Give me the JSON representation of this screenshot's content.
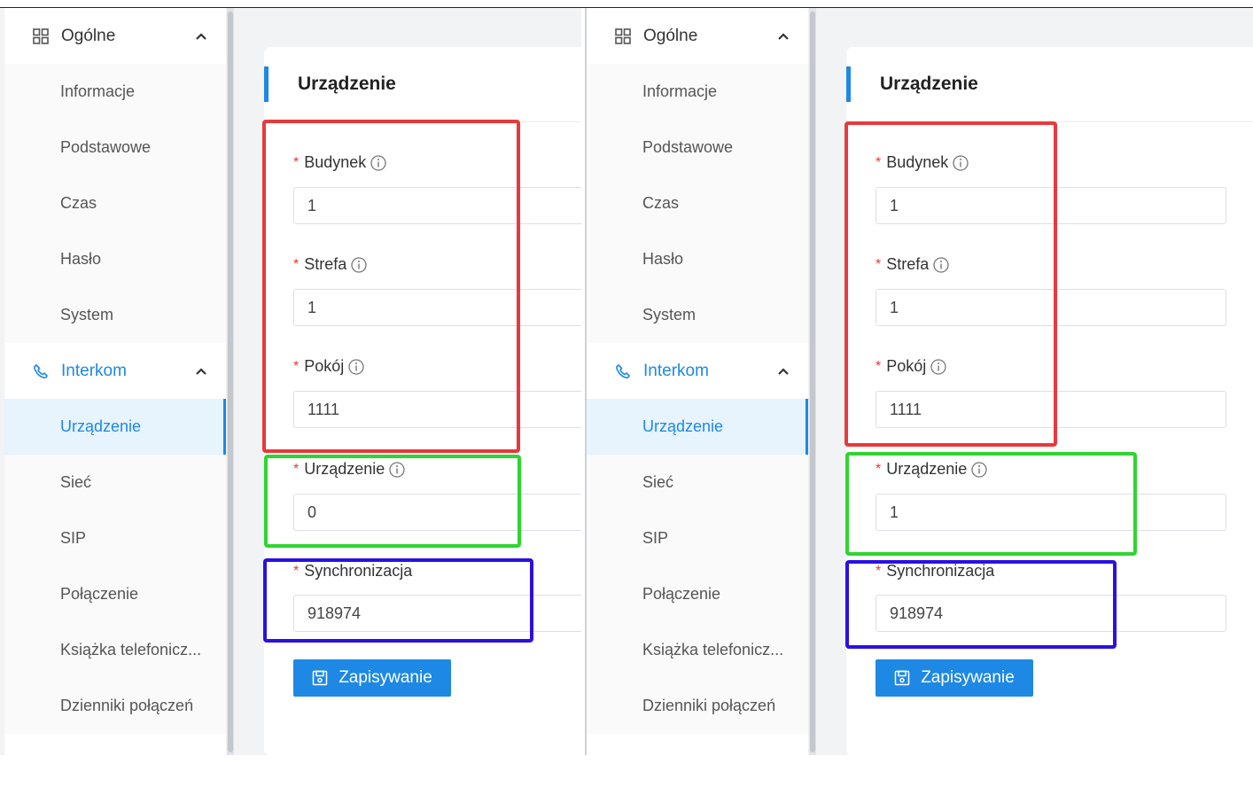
{
  "sidebar": {
    "group_general": "Ogólne",
    "items_general": [
      "Informacje",
      "Podstawowe",
      "Czas",
      "Hasło",
      "System"
    ],
    "group_intercom": "Interkom",
    "items_intercom": [
      "Urządzenie",
      "Sieć",
      "SIP",
      "Połączenie",
      "Książka telefonicz...",
      "Dzienniki połączeń"
    ],
    "active_item": "Urządzenie"
  },
  "card": {
    "title": "Urządzenie",
    "fields": {
      "building": "Budynek",
      "zone": "Strefa",
      "room": "Pokój",
      "device": "Urządzenie",
      "sync": "Synchronizacja"
    },
    "save_label": "Zapisywanie"
  },
  "left_panel": {
    "building": "1",
    "zone": "1",
    "room": "1111",
    "device": "0",
    "sync": "918974"
  },
  "right_panel": {
    "building": "1",
    "zone": "1",
    "room": "1111",
    "device": "1",
    "sync": "918974"
  },
  "icons": {
    "general": "grid-icon",
    "intercom": "phone-icon",
    "collapse": "chevron-up-icon",
    "info": "info-icon",
    "save": "save-icon"
  },
  "colors": {
    "accent": "#1e88e5",
    "highlight_red": "#e8393c",
    "highlight_green": "#2fd52f",
    "highlight_blue": "#2b10e0",
    "required": "#e53935"
  }
}
